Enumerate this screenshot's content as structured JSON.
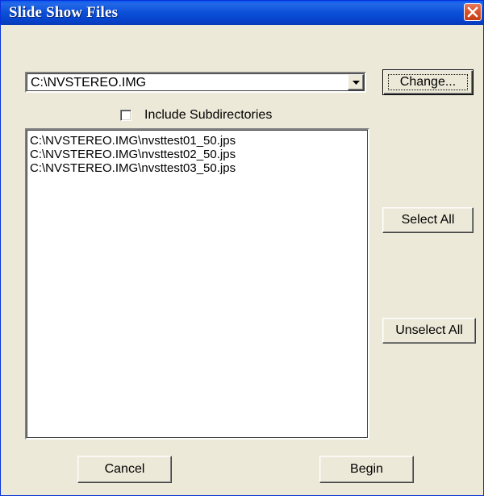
{
  "window": {
    "title": "Slide Show Files"
  },
  "directory": {
    "value": "C:\\NVSTEREO.IMG"
  },
  "include_subdirectories": {
    "label": "Include Subdirectories",
    "checked": false
  },
  "files": [
    "C:\\NVSTEREO.IMG\\nvsttest01_50.jps",
    "C:\\NVSTEREO.IMG\\nvsttest02_50.jps",
    "C:\\NVSTEREO.IMG\\nvsttest03_50.jps"
  ],
  "buttons": {
    "change": "Change...",
    "select_all": "Select All",
    "unselect_all": "Unselect All",
    "cancel": "Cancel",
    "begin": "Begin"
  },
  "icons": {
    "close": "close-icon",
    "dropdown": "chevron-down-icon"
  },
  "colors": {
    "titlebar": "#0b4fd8",
    "close": "#d9532d",
    "dialog_bg": "#ece9d8"
  }
}
